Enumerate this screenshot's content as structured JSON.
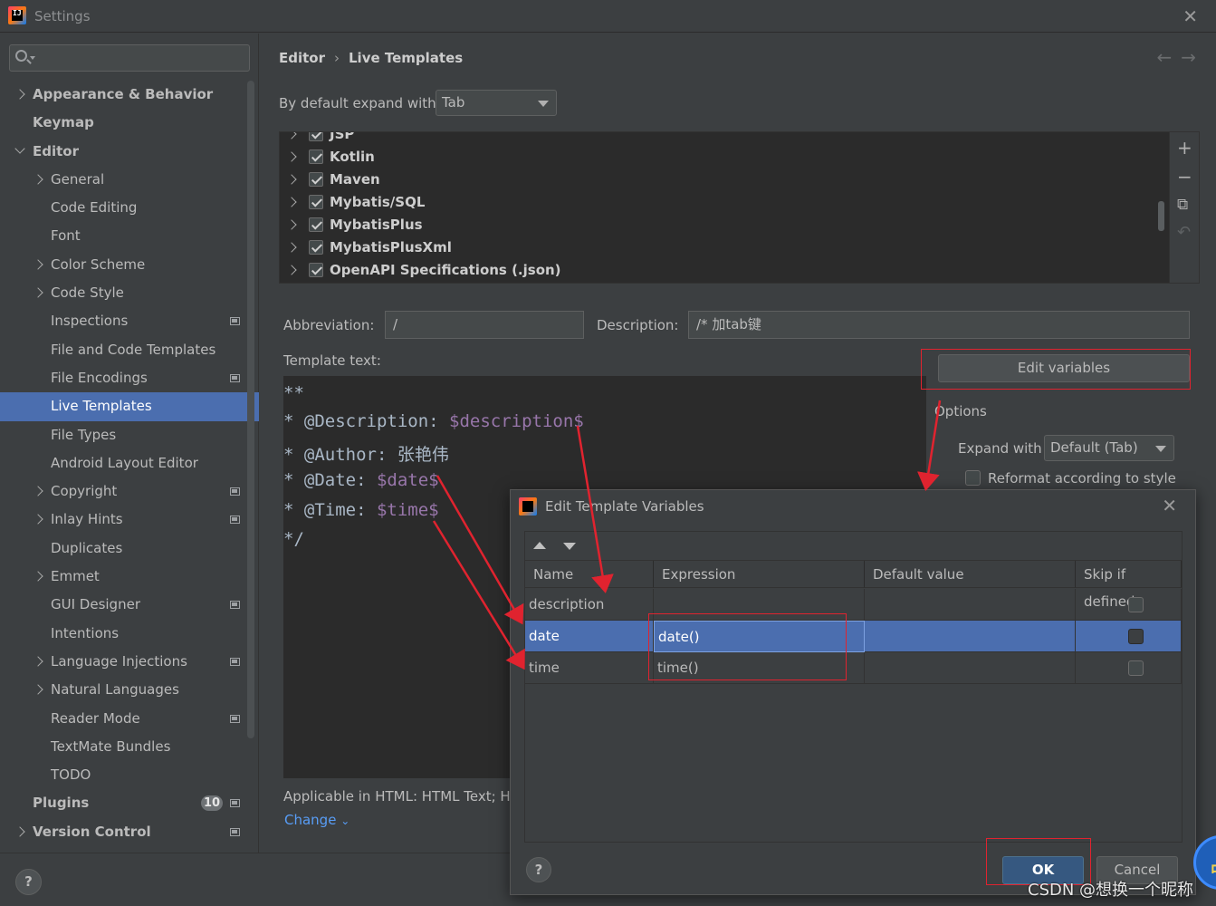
{
  "window": {
    "title": "Settings"
  },
  "sidebar": {
    "search_placeholder": "",
    "items": [
      {
        "label": "Appearance & Behavior",
        "level": 0,
        "bold": true,
        "chevron": "right"
      },
      {
        "label": "Keymap",
        "level": 0,
        "bold": true,
        "chevron": "none"
      },
      {
        "label": "Editor",
        "level": 0,
        "bold": true,
        "chevron": "down"
      },
      {
        "label": "General",
        "level": 1,
        "chevron": "right"
      },
      {
        "label": "Code Editing",
        "level": 1,
        "chevron": "none"
      },
      {
        "label": "Font",
        "level": 1,
        "chevron": "none"
      },
      {
        "label": "Color Scheme",
        "level": 1,
        "chevron": "right"
      },
      {
        "label": "Code Style",
        "level": 1,
        "chevron": "right"
      },
      {
        "label": "Inspections",
        "level": 1,
        "chevron": "none",
        "project_icon": true
      },
      {
        "label": "File and Code Templates",
        "level": 1,
        "chevron": "none"
      },
      {
        "label": "File Encodings",
        "level": 1,
        "chevron": "none",
        "project_icon": true
      },
      {
        "label": "Live Templates",
        "level": 1,
        "chevron": "none",
        "selected": true
      },
      {
        "label": "File Types",
        "level": 1,
        "chevron": "none"
      },
      {
        "label": "Android Layout Editor",
        "level": 1,
        "chevron": "none"
      },
      {
        "label": "Copyright",
        "level": 1,
        "chevron": "right",
        "project_icon": true
      },
      {
        "label": "Inlay Hints",
        "level": 1,
        "chevron": "right",
        "project_icon": true
      },
      {
        "label": "Duplicates",
        "level": 1,
        "chevron": "none"
      },
      {
        "label": "Emmet",
        "level": 1,
        "chevron": "right"
      },
      {
        "label": "GUI Designer",
        "level": 1,
        "chevron": "none",
        "project_icon": true
      },
      {
        "label": "Intentions",
        "level": 1,
        "chevron": "none"
      },
      {
        "label": "Language Injections",
        "level": 1,
        "chevron": "right",
        "project_icon": true
      },
      {
        "label": "Natural Languages",
        "level": 1,
        "chevron": "right"
      },
      {
        "label": "Reader Mode",
        "level": 1,
        "chevron": "none",
        "project_icon": true
      },
      {
        "label": "TextMate Bundles",
        "level": 1,
        "chevron": "none"
      },
      {
        "label": "TODO",
        "level": 1,
        "chevron": "none"
      },
      {
        "label": "Plugins",
        "level": 0,
        "bold": true,
        "chevron": "none",
        "badge": "10",
        "project_icon": true
      },
      {
        "label": "Version Control",
        "level": 0,
        "bold": true,
        "chevron": "right",
        "project_icon": true
      }
    ]
  },
  "breadcrumb": {
    "parent": "Editor",
    "current": "Live Templates",
    "separator": "›"
  },
  "nav": {
    "back": "←",
    "forward": "→"
  },
  "expand_default": {
    "label": "By default expand with",
    "value": "Tab"
  },
  "template_groups": [
    {
      "label": "JSP",
      "checked": true
    },
    {
      "label": "Kotlin",
      "checked": true
    },
    {
      "label": "Maven",
      "checked": true
    },
    {
      "label": "Mybatis/SQL",
      "checked": true
    },
    {
      "label": "MybatisPlus",
      "checked": true
    },
    {
      "label": "MybatisPlusXml",
      "checked": true
    },
    {
      "label": "OpenAPI Specifications (.json)",
      "checked": true
    }
  ],
  "list_tools": {
    "add": "+",
    "remove": "−",
    "copy": "⧉",
    "restore": "↶"
  },
  "form": {
    "abbreviation_label": "Abbreviation:",
    "abbreviation_value": "/",
    "description_label": "Description:",
    "description_value": "/*  加tab键",
    "template_text_label": "Template text:",
    "edit_variables_label": "Edit variables",
    "options_label": "Options",
    "expand_with_label": "Expand with",
    "expand_with_value": "Default (Tab)",
    "reformat_label": "Reformat according to style",
    "applicable_text": "Applicable in HTML: HTML Text; H",
    "change_link": "Change"
  },
  "template_code": {
    "l1": "**",
    "l2_prefix": "* @Description: ",
    "l2_var": "$description$",
    "l3_prefix": "* @Author: ",
    "l3_text": "张艳伟",
    "l4_prefix": "* @Date: ",
    "l4_var": "$date$",
    "l5_prefix": "* @Time: ",
    "l5_var": "$time$",
    "l6": "*/"
  },
  "dialog": {
    "title": "Edit Template Variables",
    "columns": [
      "Name",
      "Expression",
      "Default value",
      "Skip if defined"
    ],
    "rows": [
      {
        "name": "description",
        "expression": "",
        "default": "",
        "skip": false,
        "selected": false
      },
      {
        "name": "date",
        "expression": "date()",
        "default": "",
        "skip": false,
        "selected": true
      },
      {
        "name": "time",
        "expression": "time()",
        "default": "",
        "skip": false,
        "selected": false
      }
    ],
    "ok_label": "OK",
    "cancel_label": "Cancel",
    "help_label": "?"
  },
  "bottom": {
    "help_label": "?"
  },
  "watermark": "CSDN @想换一个昵称",
  "ime_badge": "中",
  "colors": {
    "background": "#3c3f41",
    "editor_bg": "#2b2b2b",
    "selection": "#4b6eaf",
    "template_variable": "#9876aa",
    "annotation_red": "#e0232f",
    "link": "#589df6"
  }
}
